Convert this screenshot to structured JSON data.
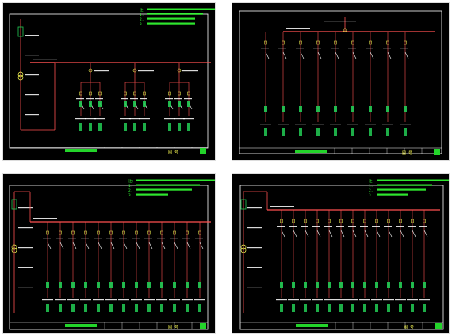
{
  "colors": {
    "background": "#000000",
    "frame": "#ffffff",
    "bus": "#ff5050",
    "wire": "#ffffff",
    "label": "#ffffff",
    "component": "#ffff55",
    "note": "#33ff33",
    "tag": "#22cc55",
    "title_bar": "#23d42a"
  },
  "panels": [
    {
      "id": "top-left",
      "note": [
        "注：",
        "1.",
        "2.",
        "3."
      ],
      "title_text": "图 号",
      "feeders": 3,
      "has_incomer": true
    },
    {
      "id": "top-right",
      "note": [],
      "title_text": "图 号",
      "feeders": 9,
      "has_incomer": false
    },
    {
      "id": "bottom-left",
      "note": [
        "注：",
        "1.",
        "2.",
        "3."
      ],
      "title_text": "图 号",
      "feeders": 13,
      "has_incomer": true
    },
    {
      "id": "bottom-right",
      "note": [
        "注：",
        "1.",
        "2.",
        "3."
      ],
      "title_text": "图 号",
      "feeders": 13,
      "has_incomer": true
    }
  ]
}
